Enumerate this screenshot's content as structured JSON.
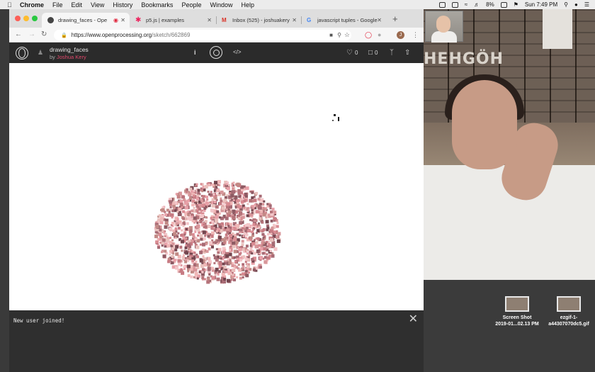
{
  "menubar": {
    "app": "Chrome",
    "items": [
      "File",
      "Edit",
      "View",
      "History",
      "Bookmarks",
      "People",
      "Window",
      "Help"
    ],
    "battery": "8%",
    "clock": "Sun 7:49 PM"
  },
  "browser": {
    "tabs": [
      {
        "title": "drawing_faces - Ope",
        "favicon_color": "#444444",
        "active": true
      },
      {
        "title": "p5.js | examples",
        "favicon_color": "#ed225d",
        "active": false
      },
      {
        "title": "Inbox (525) - joshuakery",
        "favicon_color": "#d93025",
        "active": false
      },
      {
        "title": "javascript tuples - Google",
        "favicon_color": "#4285f4",
        "active": false
      }
    ],
    "url_host": "https://www.openprocessing.org",
    "url_path": "/sketch/662869",
    "profile_initial": "J"
  },
  "openprocessing": {
    "sketch_title": "drawing_faces",
    "by_label": "by",
    "author": "Joshua Kery",
    "likes": "0",
    "comments": "0"
  },
  "console": {
    "message": "New user joined!"
  },
  "video": {
    "sign_text": "HEHGÖH"
  },
  "desktop": {
    "files": [
      {
        "line1": "Screen Shot",
        "line2": "2019-01...02.13 PM"
      },
      {
        "line1": "ezgif-1-",
        "line2": "a44307070dc5.gif"
      }
    ]
  }
}
